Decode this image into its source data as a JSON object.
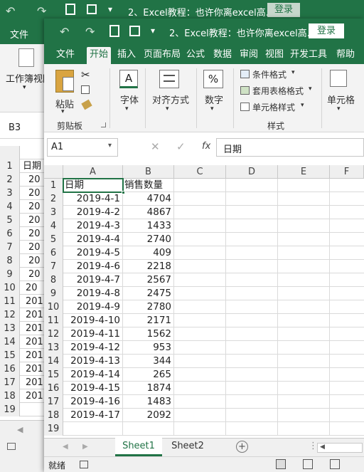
{
  "back_window": {
    "title": "2、Excel教程：也许你离excel高...",
    "login_label": "登录",
    "tab_file": "文件",
    "ribbon_label": "工作簿视图",
    "name_box": "B3",
    "row_numbers": [
      "1",
      "2",
      "3",
      "4",
      "5",
      "6",
      "7",
      "8",
      "9",
      "10",
      "11",
      "12",
      "13",
      "14",
      "15",
      "16",
      "17",
      "18",
      "19"
    ],
    "col_a_values": [
      "日期",
      "20",
      "20",
      "20",
      "20",
      "20",
      "20",
      "20",
      "20",
      "20",
      "201",
      "201",
      "201",
      "201",
      "201",
      "201",
      "201",
      "201",
      ""
    ]
  },
  "front_window": {
    "title": "2、Excel教程：也许你离excel高...",
    "login_label": "登录",
    "tabs": [
      "文件",
      "开始",
      "插入",
      "页面布局",
      "公式",
      "数据",
      "审阅",
      "视图",
      "开发工具",
      "帮助"
    ],
    "active_tab": "开始",
    "ribbon": {
      "paste_label": "粘贴",
      "clipboard_label": "剪贴板",
      "font_label": "字体",
      "align_label": "对齐方式",
      "number_label": "数字",
      "conditional_format": "条件格式",
      "table_format": "套用表格格式",
      "cell_style": "单元格样式",
      "styles_group": "样式",
      "cells_label": "单元格"
    },
    "formula_bar": {
      "name_box": "A1",
      "fx_label": "fx",
      "content": "日期"
    },
    "columns": [
      "A",
      "B",
      "C",
      "D",
      "E",
      "F"
    ],
    "rows": [
      {
        "n": "1",
        "a": "日期",
        "b": "销售数量"
      },
      {
        "n": "2",
        "a": "2019-4-1",
        "b": "4704"
      },
      {
        "n": "3",
        "a": "2019-4-2",
        "b": "4867"
      },
      {
        "n": "4",
        "a": "2019-4-3",
        "b": "1433"
      },
      {
        "n": "5",
        "a": "2019-4-4",
        "b": "2740"
      },
      {
        "n": "6",
        "a": "2019-4-5",
        "b": "409"
      },
      {
        "n": "7",
        "a": "2019-4-6",
        "b": "2218"
      },
      {
        "n": "8",
        "a": "2019-4-7",
        "b": "2567"
      },
      {
        "n": "9",
        "a": "2019-4-8",
        "b": "2475"
      },
      {
        "n": "10",
        "a": "2019-4-9",
        "b": "2780"
      },
      {
        "n": "11",
        "a": "2019-4-10",
        "b": "2171"
      },
      {
        "n": "12",
        "a": "2019-4-11",
        "b": "1562"
      },
      {
        "n": "13",
        "a": "2019-4-12",
        "b": "953"
      },
      {
        "n": "14",
        "a": "2019-4-13",
        "b": "344"
      },
      {
        "n": "15",
        "a": "2019-4-14",
        "b": "265"
      },
      {
        "n": "16",
        "a": "2019-4-15",
        "b": "1874"
      },
      {
        "n": "17",
        "a": "2019-4-16",
        "b": "1483"
      },
      {
        "n": "18",
        "a": "2019-4-17",
        "b": "2092"
      },
      {
        "n": "19",
        "a": "",
        "b": ""
      }
    ],
    "sheets": [
      "Sheet1",
      "Sheet2"
    ],
    "active_sheet": "Sheet1",
    "status_text": "就绪"
  },
  "colors": {
    "excel_green": "#217346",
    "ribbon_bg": "#f3f3f3"
  }
}
